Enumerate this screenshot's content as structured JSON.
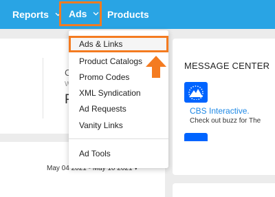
{
  "nav": {
    "reports_label": "Reports",
    "ads_label": "Ads",
    "products_label": "Products"
  },
  "dropdown": {
    "items": [
      {
        "label": "Ads & Links"
      },
      {
        "label": "Product Catalogs"
      },
      {
        "label": "Promo Codes"
      },
      {
        "label": "XML Syndication"
      },
      {
        "label": "Ad Requests"
      },
      {
        "label": "Vanity Links"
      },
      {
        "label": "Ad Tools"
      }
    ],
    "highlighted_item": "Ads & Links"
  },
  "background": {
    "frag_c": "C",
    "frag_w": "W",
    "frag_p": "P",
    "date_range": "May 04 2021 - May 10 2021 ▾"
  },
  "message_center": {
    "title": "MESSAGE CENTER",
    "message_name": "CBS Interactive.",
    "message_desc": "Check out buzz for The",
    "logo_icon": "paramount-mountain-icon"
  },
  "colors": {
    "nav_bg": "#29a4e4",
    "highlight": "#f47b20",
    "logo_bg": "#0064ff",
    "link": "#1e88e5"
  }
}
